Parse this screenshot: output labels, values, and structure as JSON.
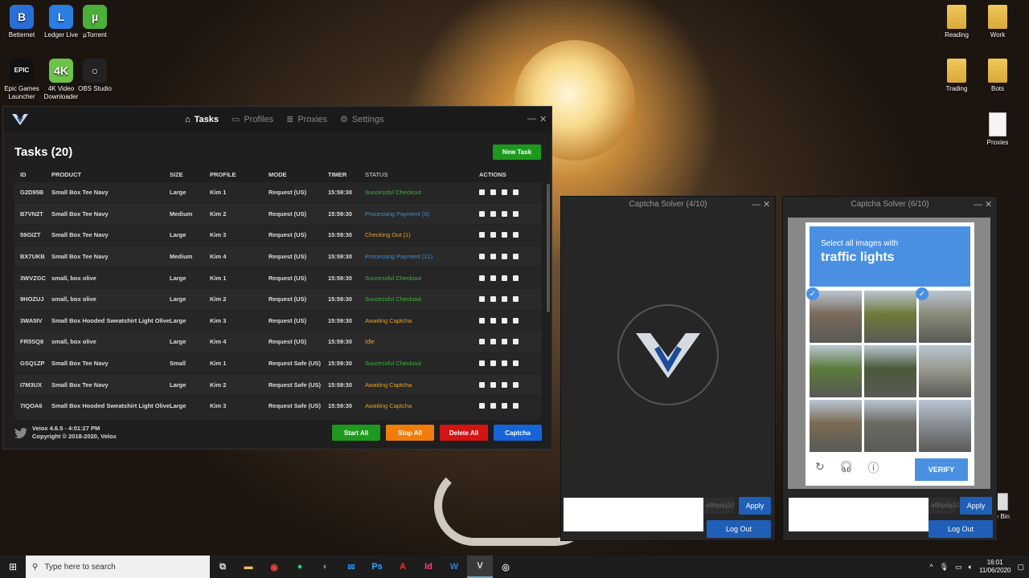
{
  "desktop": {
    "left_icons": [
      {
        "label": "Betternet",
        "color": "#2a6fd6",
        "glyph": "B"
      },
      {
        "label": "Ledger Live",
        "color": "#2a7de1",
        "glyph": "L"
      },
      {
        "label": "µTorrent",
        "color": "#4caf3a",
        "glyph": "µ"
      },
      {
        "label": "Epic Games Launcher",
        "color": "#111111",
        "glyph": "EPIC"
      },
      {
        "label": "4K Video Downloader",
        "color": "#6cc24a",
        "glyph": "4K"
      },
      {
        "label": "OBS Studio",
        "color": "#222222",
        "glyph": "○"
      }
    ],
    "right_icons": [
      {
        "label": "Reading",
        "type": "folder"
      },
      {
        "label": "Work",
        "type": "folder"
      },
      {
        "label": "Trading",
        "type": "folder"
      },
      {
        "label": "Bots",
        "type": "folder"
      },
      {
        "label": "Proxies",
        "type": "doc"
      }
    ],
    "recycle_bin_label": "le Bin"
  },
  "app": {
    "nav": [
      {
        "label": "Tasks",
        "icon": "home-icon"
      },
      {
        "label": "Profiles",
        "icon": "card-icon"
      },
      {
        "label": "Proxies",
        "icon": "list-icon"
      },
      {
        "label": "Settings",
        "icon": "gear-icon"
      }
    ],
    "heading": "Tasks (20)",
    "new_task": "New Task",
    "columns": [
      "ID",
      "PRODUCT",
      "SIZE",
      "PROFILE",
      "MODE",
      "TIMER",
      "STATUS",
      "ACTIONS"
    ],
    "rows": [
      {
        "id": "G2D95B",
        "product": "Small Box Tee Navy",
        "size": "Large",
        "profile": "Kim 1",
        "mode": "Request (US)",
        "timer": "15:59:30",
        "status": "Successful Checkout",
        "color": "#3fb43f"
      },
      {
        "id": "B7VN2T",
        "product": "Small Box Tee Navy",
        "size": "Medium",
        "profile": "Kim 2",
        "mode": "Request (US)",
        "timer": "15:59:30",
        "status": "Processing Payment (9)",
        "color": "#3a8fd8"
      },
      {
        "id": "59GIZT",
        "product": "Small Box Tee Navy",
        "size": "Large",
        "profile": "Kim 3",
        "mode": "Request (US)",
        "timer": "15:59:30",
        "status": "Checking Out (1)",
        "color": "#e8a020"
      },
      {
        "id": "BX7UKB",
        "product": "Small Box Tee Navy",
        "size": "Medium",
        "profile": "Kim 4",
        "mode": "Request (US)",
        "timer": "15:59:30",
        "status": "Processing Payment (12)",
        "color": "#3a8fd8"
      },
      {
        "id": "3WVZGC",
        "product": "small, box olive",
        "size": "Large",
        "profile": "Kim 1",
        "mode": "Request (US)",
        "timer": "15:59:30",
        "status": "Successful Checkout",
        "color": "#3fb43f"
      },
      {
        "id": "9HOZUJ",
        "product": "small, box olive",
        "size": "Large",
        "profile": "Kim 2",
        "mode": "Request (US)",
        "timer": "15:59:30",
        "status": "Successful Checkout",
        "color": "#3fb43f"
      },
      {
        "id": "3WA5IV",
        "product": "Small Box Hooded Sweatshirt Light Olive",
        "size": "Large",
        "profile": "Kim 3",
        "mode": "Request (US)",
        "timer": "15:59:30",
        "status": "Awaiting Captcha",
        "color": "#e8a020"
      },
      {
        "id": "FR5SQ8",
        "product": "small, box olive",
        "size": "Large",
        "profile": "Kim 4",
        "mode": "Request (US)",
        "timer": "15:59:30",
        "status": "Idle",
        "color": "#e8a020"
      },
      {
        "id": "GSQ1ZP",
        "product": "Small Box Tee Navy",
        "size": "Small",
        "profile": "Kim 1",
        "mode": "Request Safe (US)",
        "timer": "15:59:30",
        "status": "Successful Checkout",
        "color": "#3fb43f"
      },
      {
        "id": "I7M3UX",
        "product": "Small Box Tee Navy",
        "size": "Large",
        "profile": "Kim 2",
        "mode": "Request Safe (US)",
        "timer": "15:59:30",
        "status": "Awaiting Captcha",
        "color": "#e8a020"
      },
      {
        "id": "7IQOA6",
        "product": "Small Box Hooded Sweatshirt Light Olive",
        "size": "Large",
        "profile": "Kim 3",
        "mode": "Request Safe (US)",
        "timer": "15:59:30",
        "status": "Awaiting Captcha",
        "color": "#e8a020"
      }
    ],
    "footer_version": "Veiox 4.6.5 - 4:01:27 PM",
    "footer_copyright": "Copyright © 2018-2020, Velox",
    "buttons": {
      "start_all": "Start All",
      "stop_all": "Stop All",
      "delete_all": "Delete All",
      "captcha": "Captcha"
    },
    "colors": {
      "green": "#1d9a1d",
      "orange": "#f07d0a",
      "red": "#d41414",
      "blue": "#1565d8"
    }
  },
  "captcha_left": {
    "title": "Captcha Solver (4/10)",
    "key": "a9bpdq3J",
    "apply": "Apply",
    "logout": "Log Out"
  },
  "captcha_right": {
    "title": "Captcha Solver (6/10)",
    "key": "a9bpdq3J",
    "apply": "Apply",
    "logout": "Log Out",
    "prompt_small": "Select all images with",
    "prompt_big": "traffic lights",
    "verify": "VERIFY",
    "tiles": [
      {
        "color": "#7a6a5a",
        "checked": true
      },
      {
        "color": "#6e7a3a",
        "checked": false
      },
      {
        "color": "#8a8a7a",
        "checked": true
      },
      {
        "color": "#5a7a3a",
        "checked": false
      },
      {
        "color": "#4a5a3a",
        "checked": false
      },
      {
        "color": "#9a9a90",
        "checked": false
      },
      {
        "color": "#7a6a55",
        "checked": false
      },
      {
        "color": "#6a6a62",
        "checked": false
      },
      {
        "color": "#8a8f96",
        "checked": false
      }
    ]
  },
  "taskbar": {
    "search_placeholder": "Type here to search",
    "time": "16:01",
    "date": "11/06/2020"
  }
}
